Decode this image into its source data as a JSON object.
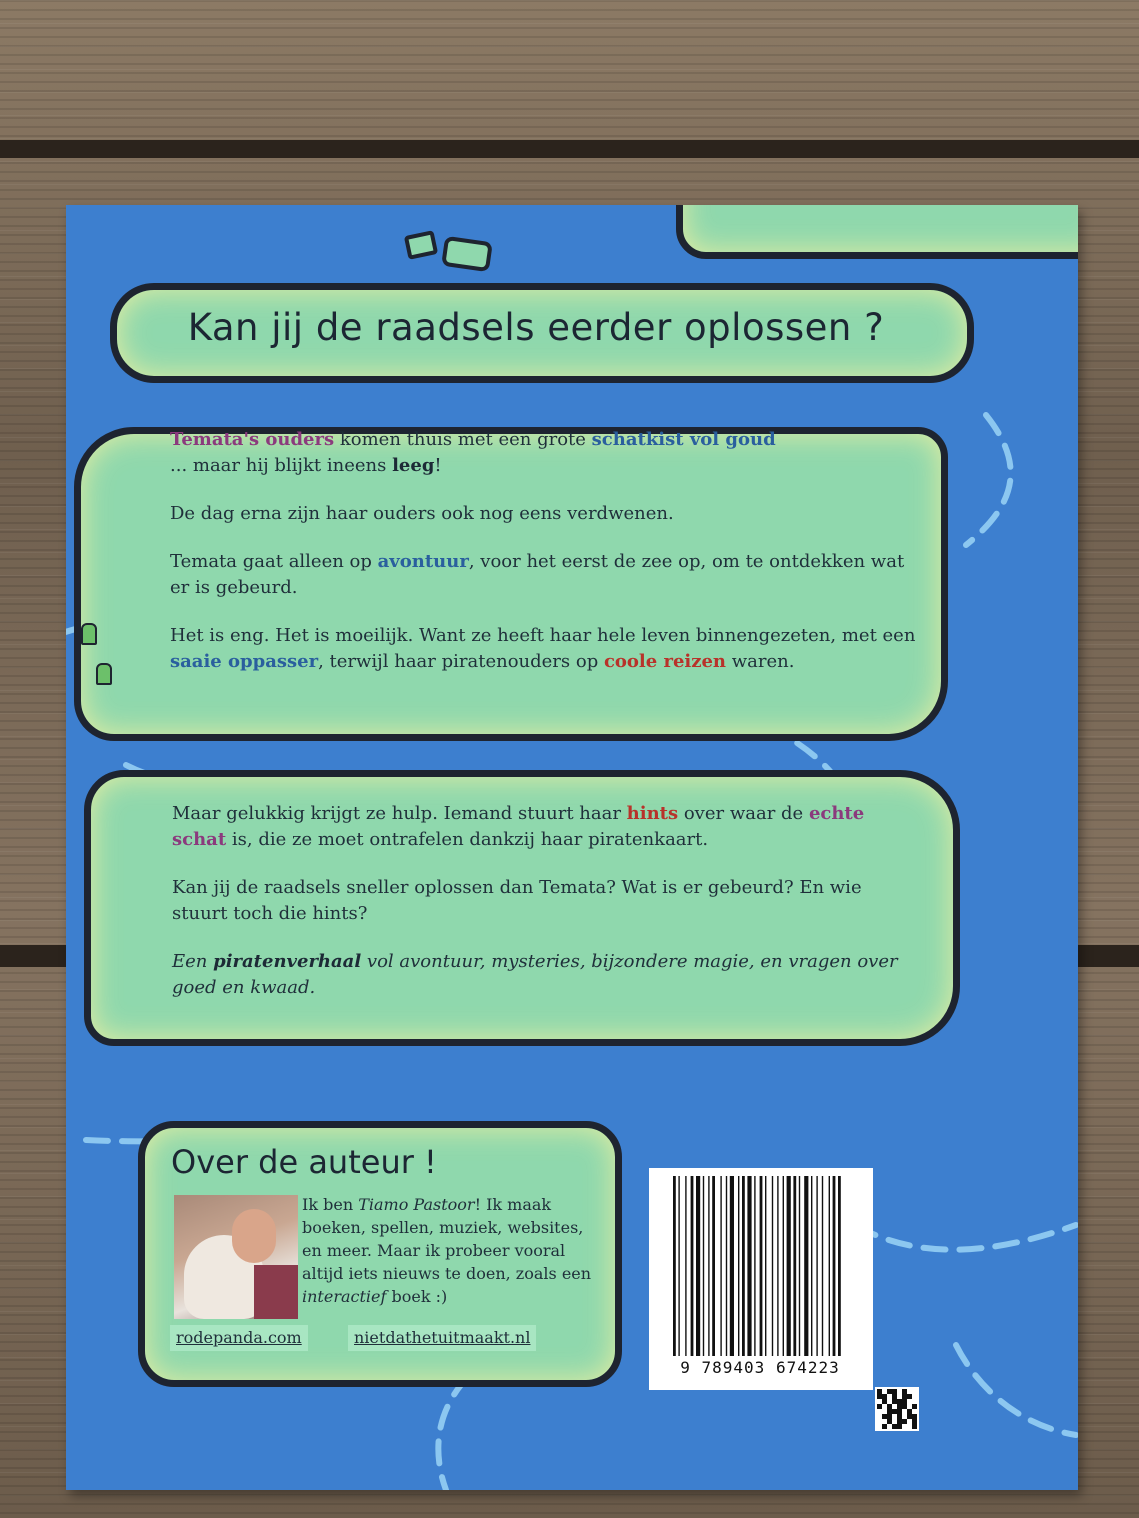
{
  "headline": "Kan jij de raadsels eerder oplossen ?",
  "para1": {
    "a": "Temata's ouders",
    "b": " komen thuis met een grote ",
    "c": "schatkist vol goud",
    "d": " ... maar hij blijkt ineens ",
    "e": "leeg",
    "f": "!"
  },
  "para2": "De dag erna zijn haar ouders ook nog eens verdwenen.",
  "para3": {
    "a": "Temata gaat alleen op ",
    "b": "avontuur",
    "c": ", voor het eerst de zee op, om te ontdekken wat er is gebeurd."
  },
  "para4": {
    "a": "Het is eng. Het is moeilijk. Want ze heeft haar hele leven binnengezeten, met een ",
    "b": "saaie oppasser",
    "c": ", terwijl haar piratenouders op ",
    "d": "coole reizen",
    "e": " waren."
  },
  "para5": {
    "a": "Maar gelukkig krijgt ze hulp. Iemand stuurt haar ",
    "b": "hints",
    "c": " over waar de ",
    "d": "echte schat",
    "e": " is, die ze moet ontrafelen dankzij haar piratenkaart."
  },
  "para6": "Kan jij de raadsels sneller oplossen dan Temata? Wat is er gebeurd? En wie stuurt toch die hints?",
  "para7": {
    "a": "Een ",
    "b": "piratenverhaal",
    "c": " vol avontuur, mysteries, bijzondere magie, en vragen over goed en kwaad."
  },
  "author": {
    "title": "Over de auteur !",
    "a": "Ik ben ",
    "b": "Tiamo Pastoor",
    "c": "! Ik maak boeken, spellen, muziek, websites, en meer. Maar ik probeer vooral altijd iets nieuws te doen, zoals een ",
    "d": "interactief",
    "e": " boek :)",
    "link1": "rodepanda.com",
    "link2": "nietdathetuitmaakt.nl"
  },
  "isbn_digits": "9 789403 674223"
}
